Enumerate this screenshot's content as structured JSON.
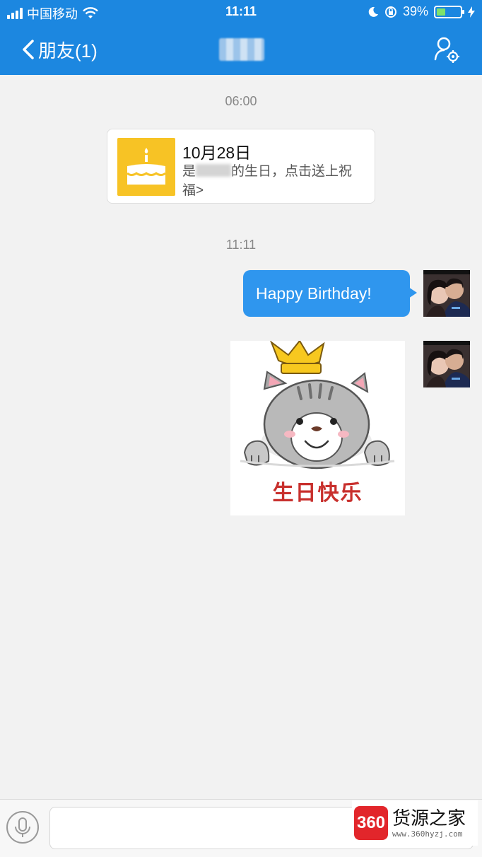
{
  "status_bar": {
    "carrier": "中国移动",
    "time": "11:11",
    "battery_percent": "39%",
    "battery_level": 0.39,
    "icons": [
      "signal-icon",
      "wifi-icon",
      "moon-icon",
      "orientation-lock-icon",
      "battery-icon",
      "charging-icon"
    ]
  },
  "nav": {
    "back_label": "朋友(1)",
    "right_icon": "profile-settings-icon",
    "accent": "#1c87e0"
  },
  "chat": {
    "timestamp_1": "06:00",
    "birthday_card": {
      "date": "10月28日",
      "desc_prefix": "是",
      "desc_suffix": "的生日，点击送上祝福>",
      "icon": "birthday-cake-icon",
      "icon_color": "#f7c325"
    },
    "timestamp_2": "11:11",
    "message_text": "Happy Birthday!",
    "bubble_color": "#2f96ee",
    "sticker": {
      "text": "生日快乐",
      "subject": "cat-with-crown"
    }
  },
  "input_bar": {
    "voice_icon": "microphone-icon",
    "text_value": ""
  },
  "watermark": {
    "badge": "360",
    "title": "货源之家",
    "url": "www.360hyzj.com"
  }
}
